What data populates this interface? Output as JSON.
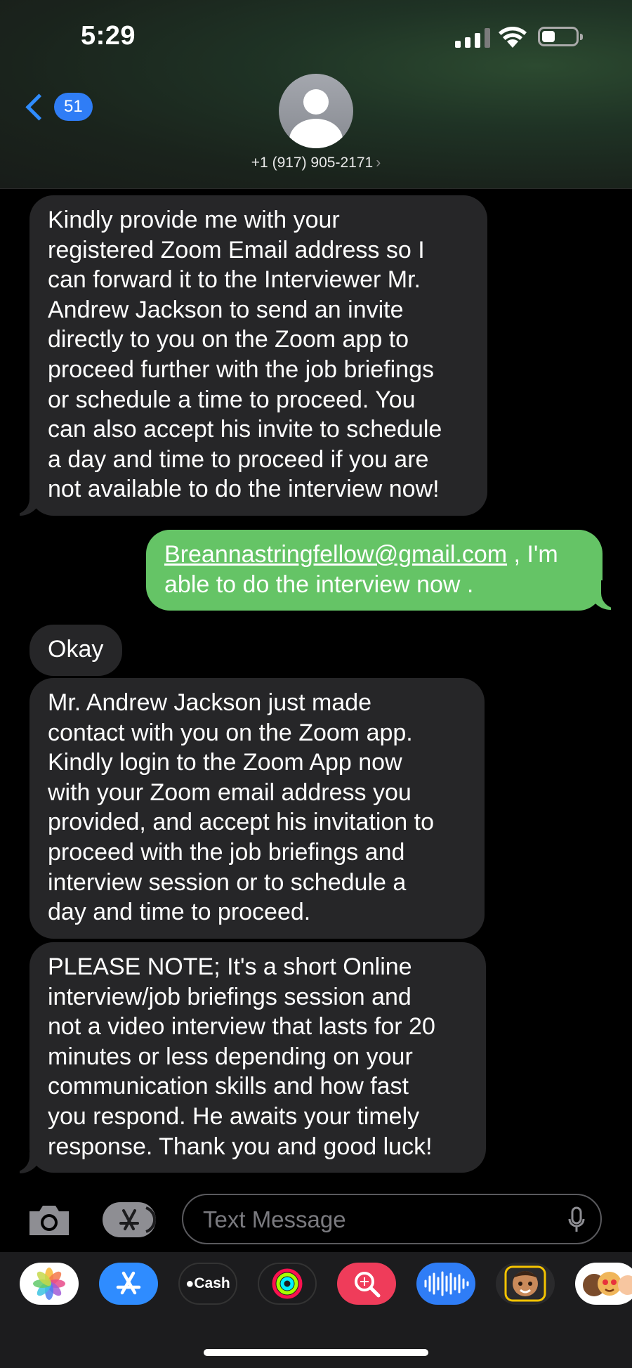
{
  "status_bar": {
    "time": "5:29"
  },
  "header": {
    "back_count": "51",
    "contact": "+1 (917) 905-2171"
  },
  "messages": [
    {
      "direction": "incoming",
      "lines": [
        "Kindly provide me with your",
        "registered Zoom Email address so I",
        "can forward it to the Interviewer Mr.",
        "Andrew Jackson to send an invite",
        "directly to you on the Zoom app to",
        "proceed further with the job briefings",
        "or schedule a time to proceed. You",
        "can also accept his invite to schedule",
        "a day and time to proceed if you are",
        "not available to do the interview now!"
      ]
    },
    {
      "direction": "outgoing",
      "link": "Breannastringfellow@gmail.com",
      "line1_rest": " , I'm",
      "line2": "able to do the interview now ."
    },
    {
      "direction": "incoming",
      "lines": [
        "Okay"
      ]
    },
    {
      "direction": "incoming",
      "lines": [
        "Mr. Andrew Jackson just made",
        "contact with you on the Zoom app.",
        "Kindly login to the Zoom App now",
        "with your Zoom email address you",
        "provided, and accept his invitation to",
        "proceed with the job briefings and",
        "interview session or to schedule a",
        "day and time to proceed."
      ]
    },
    {
      "direction": "incoming",
      "lines": [
        "PLEASE NOTE; It's a short Online",
        "interview/job briefings session and",
        "not a video interview that lasts for 20",
        "minutes or less depending on your",
        "communication skills and how fast",
        "you respond. He awaits your timely",
        "response. Thank you and good luck!"
      ]
    }
  ],
  "composer": {
    "placeholder": "Text Message"
  },
  "app_strip": [
    {
      "name": "photos-app",
      "label": ""
    },
    {
      "name": "app-store-app",
      "label": ""
    },
    {
      "name": "apple-cash-app",
      "label": "Cash"
    },
    {
      "name": "activity-app",
      "label": ""
    },
    {
      "name": "search-images-app",
      "label": ""
    },
    {
      "name": "audio-app",
      "label": ""
    },
    {
      "name": "memoji-app",
      "label": ""
    },
    {
      "name": "memoji-stickers-app",
      "label": ""
    }
  ],
  "colors": {
    "incoming_bubble": "#262628",
    "outgoing_bubble": "#65c466",
    "accent": "#2f8cff"
  }
}
